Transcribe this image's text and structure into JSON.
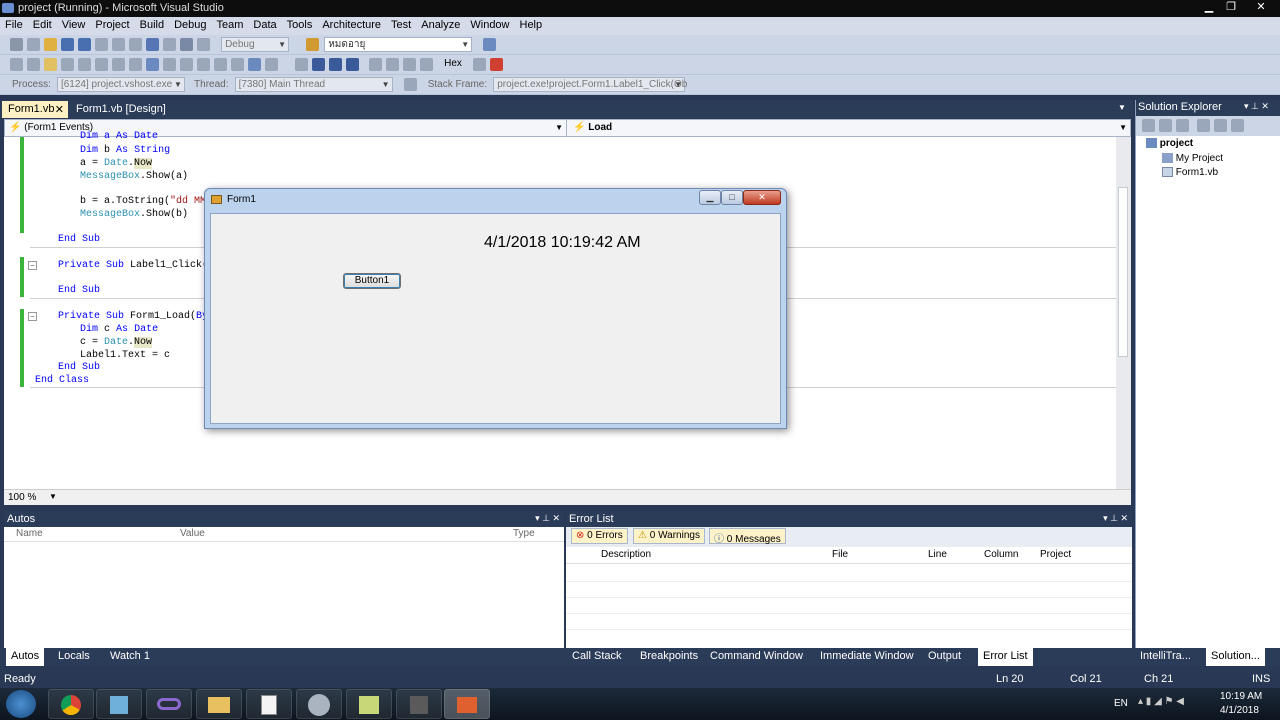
{
  "window": {
    "title": "project (Running) - Microsoft Visual Studio"
  },
  "menu": [
    "File",
    "Edit",
    "View",
    "Project",
    "Build",
    "Debug",
    "Team",
    "Data",
    "Tools",
    "Architecture",
    "Test",
    "Analyze",
    "Window",
    "Help"
  ],
  "toolbar": {
    "config": "Debug",
    "search_combo": "หมดอายุ",
    "hex_label": "Hex"
  },
  "debug_bar": {
    "process_label": "Process:",
    "process_value": "[6124] project.vshost.exe",
    "thread_label": "Thread:",
    "thread_value": "[7380] Main Thread",
    "stack_label": "Stack Frame:",
    "stack_value": "project.exe!project.Form1.Label1_Click(Ob"
  },
  "doc_tabs": {
    "active": "Form1.vb",
    "other": "Form1.vb [Design]"
  },
  "navbar": {
    "left": "(Form1 Events)",
    "right": "Load"
  },
  "code": {
    "l1": "Dim a As Date",
    "l2": "Dim b As String",
    "l3": "a = Date.Now",
    "l4": "MessageBox.Show(a)",
    "l5": "b = a.ToString(\"dd MMM",
    "l6": "MessageBox.Show(b)",
    "l7": "End Sub",
    "l8": "Private Sub Label1_Click(By",
    "l9": "End Sub",
    "l10": "Private Sub Form1_Load(ByV",
    "l11": "Dim c As Date",
    "l12": "c = Date.Now",
    "l13": "Label1.Text = c",
    "l14": "End Sub",
    "l15": "End Class"
  },
  "zoom": "100 %",
  "form1": {
    "title": "Form1",
    "label_text": "4/1/2018 10:19:42 AM",
    "button_label": "Button1"
  },
  "solution_explorer": {
    "title": "Solution Explorer",
    "root": "project",
    "items": [
      "My Project",
      "Form1.vb"
    ]
  },
  "autos": {
    "title": "Autos",
    "columns": [
      "Name",
      "Value",
      "Type"
    ]
  },
  "error_list": {
    "title": "Error List",
    "errors": "0 Errors",
    "warnings": "0 Warnings",
    "messages": "0 Messages",
    "columns": [
      "Description",
      "File",
      "Line",
      "Column",
      "Project"
    ]
  },
  "bottom_tabs_left": [
    "Autos",
    "Locals",
    "Watch 1"
  ],
  "bottom_tabs_right": [
    "Call Stack",
    "Breakpoints",
    "Command Window",
    "Immediate Window",
    "Output",
    "Error List"
  ],
  "side_tabs": [
    "IntelliTra...",
    "Solution..."
  ],
  "status": {
    "text": "Ready",
    "ln": "Ln 20",
    "col": "Col 21",
    "ch": "Ch 21",
    "ins": "INS"
  },
  "tray": {
    "lang": "EN",
    "time": "10:19 AM",
    "date": "4/1/2018"
  }
}
